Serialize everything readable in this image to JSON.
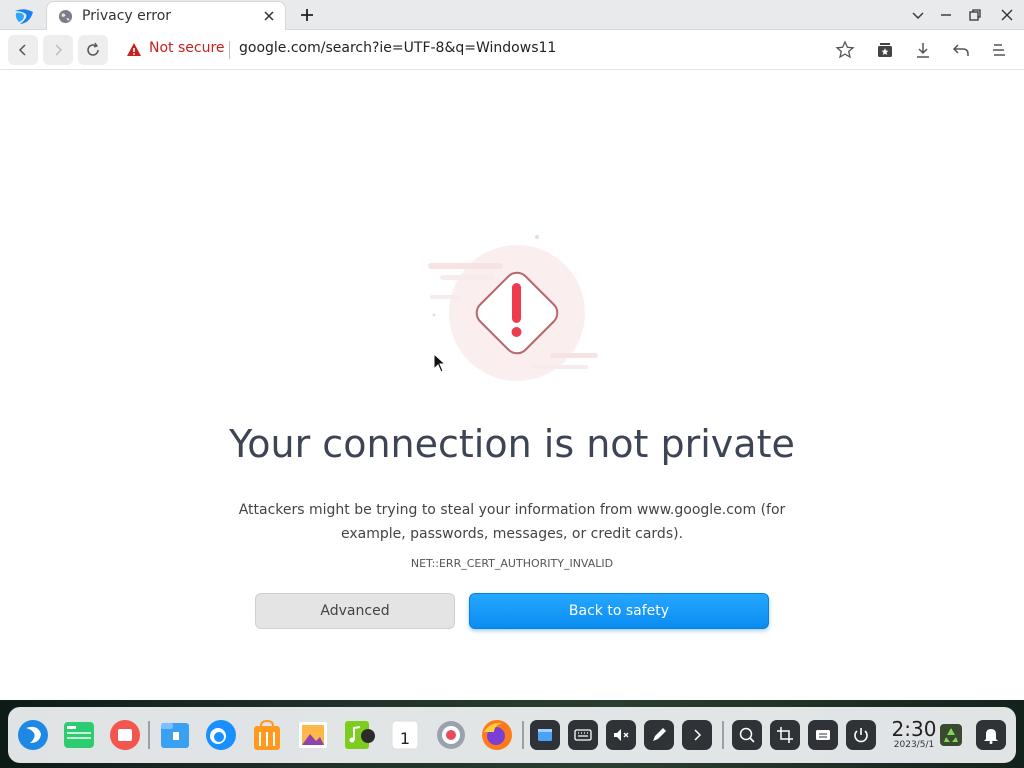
{
  "tab": {
    "title": "Privacy error"
  },
  "address": {
    "security_label": "Not secure",
    "url": "google.com/search?ie=UTF-8&q=Windows11"
  },
  "error": {
    "heading": "Your connection is not private",
    "description": "Attackers might be trying to steal your information from www.google.com (for example, passwords, messages, or credit cards).",
    "code": "NET::ERR_CERT_AUTHORITY_INVALID",
    "advanced_label": "Advanced",
    "back_label": "Back to safety"
  },
  "taskbar": {
    "time": "2:30",
    "date": "2023/5/1",
    "apps": [
      "launcher-icon",
      "multitasking-icon",
      "screen-recorder-icon",
      "file-manager-icon",
      "browser-icon",
      "app-store-icon",
      "image-viewer-icon",
      "music-icon",
      "calendar-icon",
      "settings-icon",
      "firefox-icon"
    ]
  },
  "colors": {
    "accent": "#1a9cf7",
    "warning": "#c5221f",
    "heading": "#3d4555"
  },
  "icons": [
    "globe-icon",
    "close-icon",
    "plus-icon",
    "chevron-down-icon",
    "minimize-icon",
    "restore-icon",
    "back-icon",
    "forward-icon",
    "reload-icon",
    "warning-icon",
    "star-icon",
    "collections-icon",
    "download-icon",
    "undo-icon",
    "menu-icon"
  ]
}
